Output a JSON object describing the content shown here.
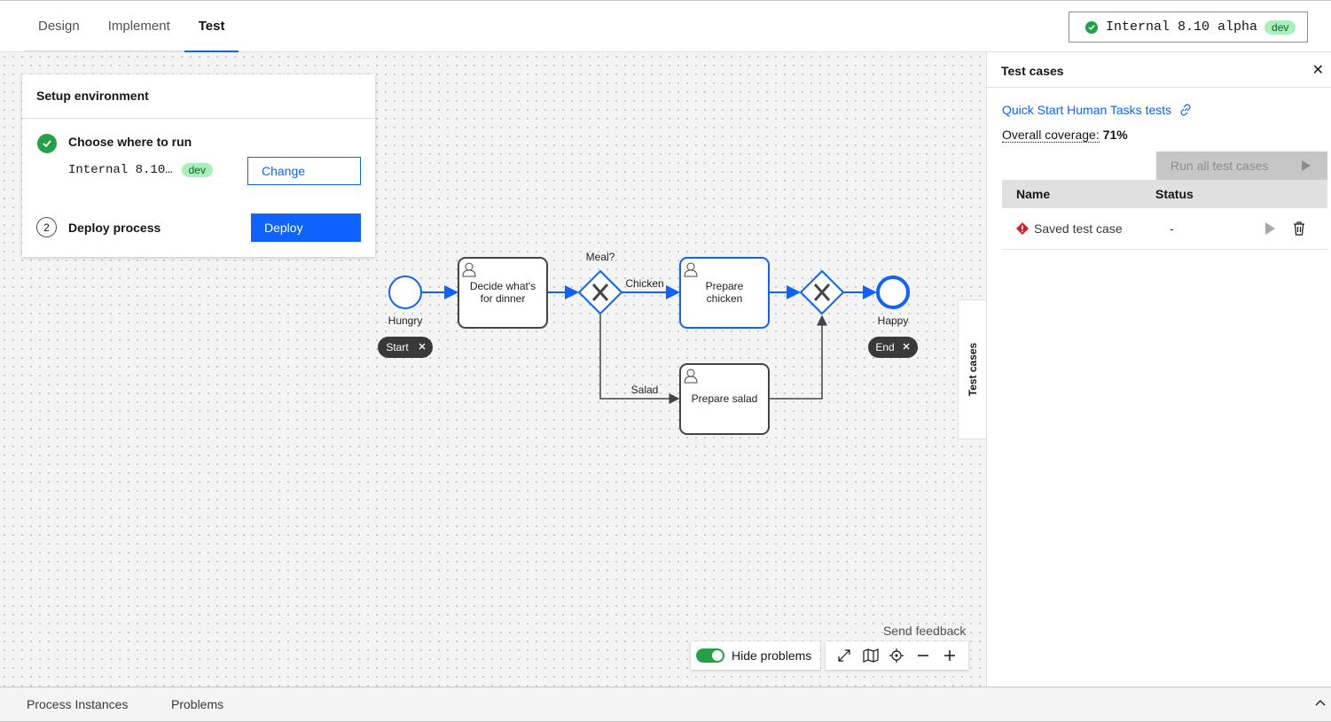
{
  "tabs": [
    {
      "label": "Design"
    },
    {
      "label": "Implement"
    },
    {
      "label": "Test"
    }
  ],
  "env_badge": {
    "label": "Internal 8.10 alpha",
    "tag": "dev"
  },
  "setup": {
    "title": "Setup environment",
    "step1_label": "Choose where to run",
    "step1_target": "Internal 8.10…",
    "step1_tag": "dev",
    "change_label": "Change",
    "step2_number": "2",
    "step2_label": "Deploy process",
    "deploy_label": "Deploy"
  },
  "diagram": {
    "start_label": "Hungry",
    "task_decide_line1": "Decide what's",
    "task_decide_line2": "for dinner",
    "gateway_label": "Meal?",
    "flow_chicken": "Chicken",
    "flow_salad": "Salad",
    "task_chicken_line1": "Prepare",
    "task_chicken_line2": "chicken",
    "task_salad": "Prepare salad",
    "end_label": "Happy",
    "start_pill": "Start",
    "end_pill": "End"
  },
  "side_tab_label": "Test cases",
  "feedback_label": "Send feedback",
  "hide_problems_label": "Hide problems",
  "panel": {
    "title": "Test cases",
    "suite_link": "Quick Start Human Tasks tests",
    "coverage_label": "Overall coverage:",
    "coverage_value": "71%",
    "run_all_label": "Run all test cases",
    "col_name": "Name",
    "col_status": "Status",
    "rows": [
      {
        "name": "Saved test case",
        "status": "-"
      }
    ]
  },
  "bottom_tabs": [
    {
      "label": "Process Instances"
    },
    {
      "label": "Problems"
    }
  ],
  "colors": {
    "accent": "#0f62fe",
    "success": "#24a148",
    "error": "#da1e28"
  }
}
